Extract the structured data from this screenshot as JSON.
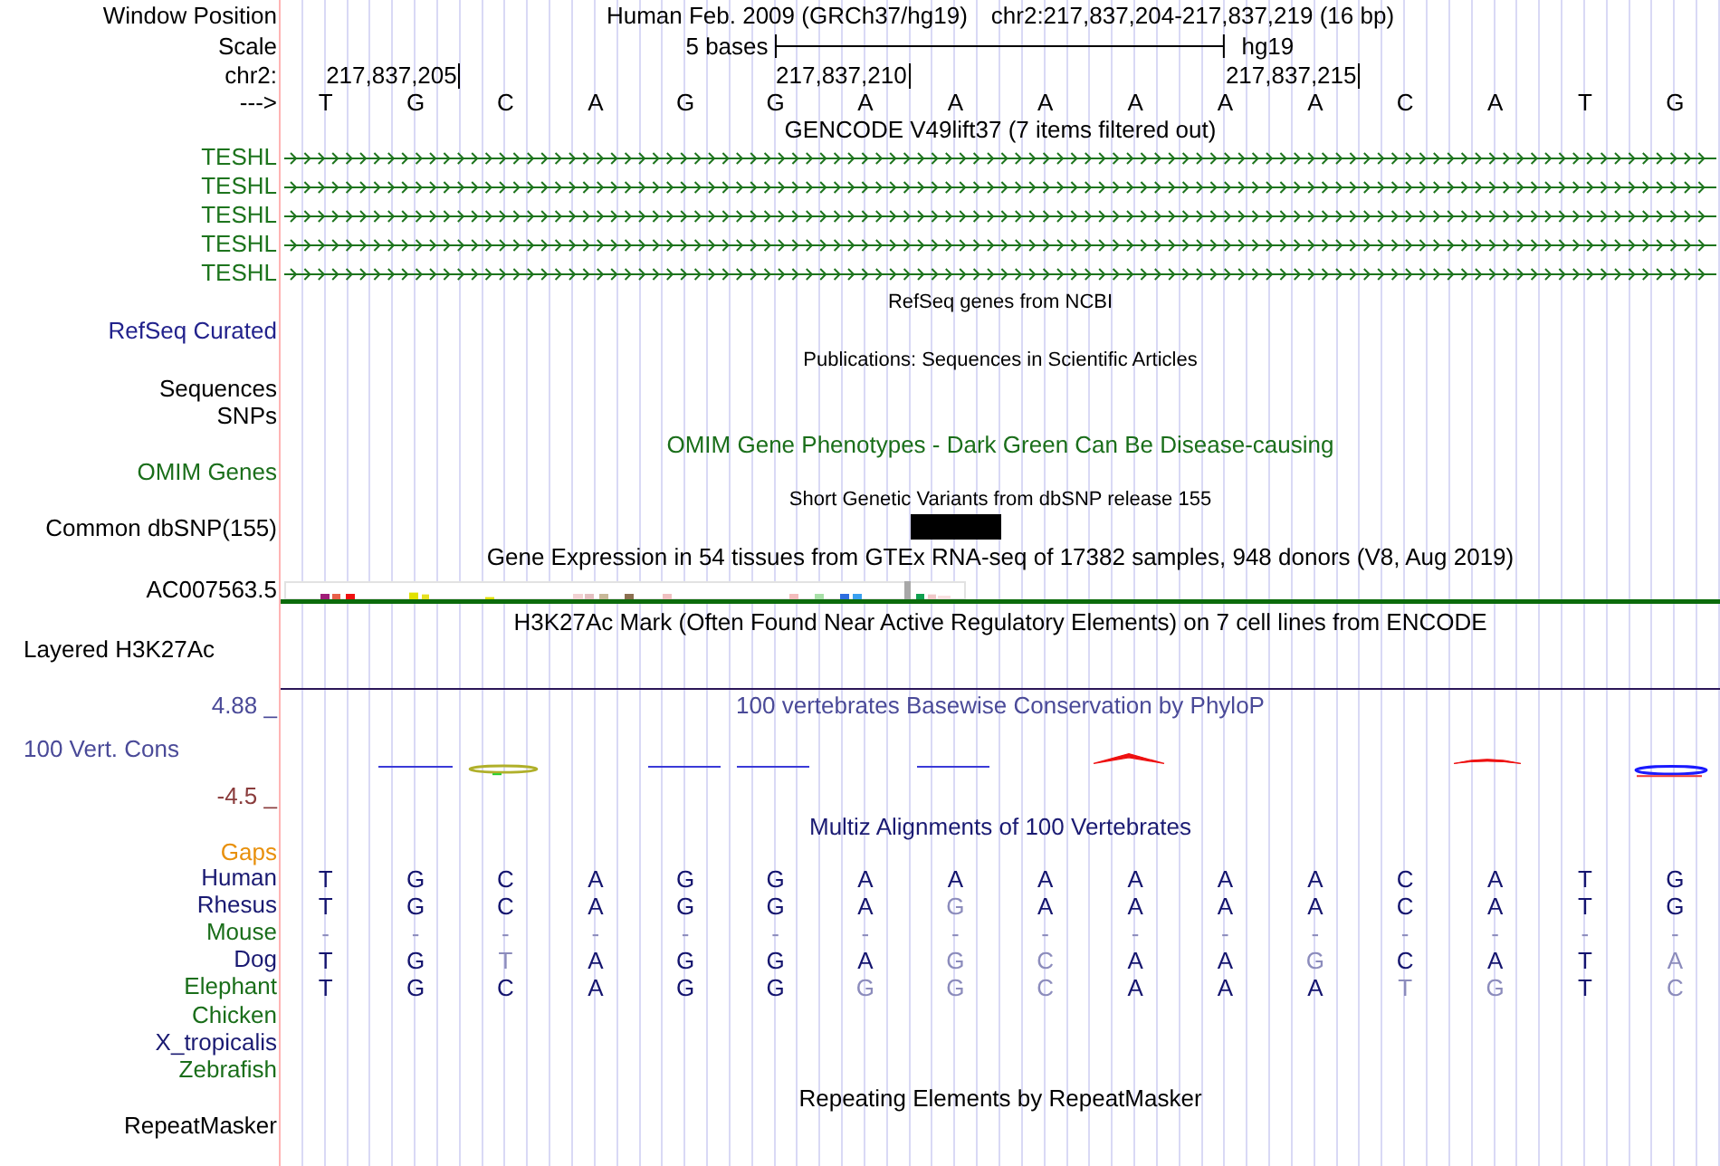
{
  "ruler": {
    "position_label": "Window Position",
    "assembly_title": "Human Feb. 2009 (GRCh37/hg19)",
    "position": "chr2:217,837,204-217,837,219 (16 bp)",
    "scale_label": "Scale",
    "scale_text": "5 bases",
    "scale_assembly": "hg19",
    "chrom_label": "chr2:",
    "ticks": [
      "217,837,205",
      "217,837,210",
      "217,837,215"
    ],
    "strand_label": "--->",
    "bases": [
      "T",
      "G",
      "C",
      "A",
      "G",
      "G",
      "A",
      "A",
      "A",
      "A",
      "A",
      "A",
      "C",
      "A",
      "T",
      "G"
    ]
  },
  "tracks": [
    {
      "kind": "genes",
      "title": "GENCODE V49lift37 (7 items filtered out)",
      "color": "#000000",
      "items": [
        {
          "label": "TESHL",
          "color": "#1d741d"
        },
        {
          "label": "TESHL",
          "color": "#1d741d"
        },
        {
          "label": "TESHL",
          "color": "#1d741d"
        },
        {
          "label": "TESHL",
          "color": "#1d741d"
        },
        {
          "label": "TESHL",
          "color": "#1d741d"
        }
      ]
    },
    {
      "kind": "compact",
      "title": "RefSeq genes from NCBI",
      "color": "#000000",
      "labels": [
        {
          "text": "RefSeq Curated",
          "color": "#22228c"
        }
      ]
    },
    {
      "kind": "compact",
      "title": "Publications: Sequences in Scientific Articles",
      "color": "#000000",
      "labels": [
        {
          "text": "Sequences",
          "color": "#000000"
        },
        {
          "text": "SNPs",
          "color": "#000000"
        }
      ]
    },
    {
      "kind": "plain",
      "title": "OMIM Gene Phenotypes - Dark Green Can Be Disease-causing",
      "color": "#1a6e1a",
      "labels": [
        {
          "text": "OMIM Genes",
          "color": "#1a6e1a"
        }
      ]
    },
    {
      "kind": "variants",
      "title": "Short Genetic Variants from dbSNP release 155",
      "color": "#000000",
      "labels": [
        {
          "text": "Common dbSNP(155)",
          "color": "#000000"
        }
      ]
    },
    {
      "kind": "expression",
      "title": "Gene Expression in 54 tissues from GTEx RNA-seq of 17382 samples, 948 donors (V8, Aug 2019)",
      "color": "#000000",
      "labels": [
        {
          "text": "AC007563.5",
          "color": "#000000"
        }
      ]
    },
    {
      "kind": "signal",
      "title": "H3K27Ac Mark (Often Found Near Active Regulatory Elements) on 7 cell lines from ENCODE",
      "color": "#000000",
      "labels": [
        {
          "text": "Layered H3K27Ac",
          "color": "#000000"
        }
      ]
    },
    {
      "kind": "conservation",
      "title": "100 vertebrates Basewise Conservation by PhyloP",
      "color": "#4a4a98",
      "max_label": {
        "text": "4.88 _",
        "color": "#4a4a98"
      },
      "labels": [
        {
          "text": "100 Vert. Cons",
          "color": "#4a4a98"
        }
      ],
      "min_label": {
        "text": "-4.5 _",
        "color": "#8a3c3c"
      }
    },
    {
      "kind": "alignment",
      "title": "Multiz Alignments of 100 Vertebrates",
      "color": "#1a1a72",
      "gaps_label": {
        "text": "Gaps",
        "color": "#e8900c"
      },
      "species": [
        {
          "name": "Human",
          "color": "#1a1a72",
          "bases": [
            {
              "base": "T",
              "match": true
            },
            {
              "base": "G",
              "match": true
            },
            {
              "base": "C",
              "match": true
            },
            {
              "base": "A",
              "match": true
            },
            {
              "base": "G",
              "match": true
            },
            {
              "base": "G",
              "match": true
            },
            {
              "base": "A",
              "match": true
            },
            {
              "base": "A",
              "match": true
            },
            {
              "base": "A",
              "match": true
            },
            {
              "base": "A",
              "match": true
            },
            {
              "base": "A",
              "match": true
            },
            {
              "base": "A",
              "match": true
            },
            {
              "base": "C",
              "match": true
            },
            {
              "base": "A",
              "match": true
            },
            {
              "base": "T",
              "match": true
            },
            {
              "base": "G",
              "match": true
            }
          ]
        },
        {
          "name": "Rhesus",
          "color": "#1a1a72",
          "bases": [
            {
              "base": "T",
              "match": true
            },
            {
              "base": "G",
              "match": true
            },
            {
              "base": "C",
              "match": true
            },
            {
              "base": "A",
              "match": true
            },
            {
              "base": "G",
              "match": true
            },
            {
              "base": "G",
              "match": true
            },
            {
              "base": "A",
              "match": true
            },
            {
              "base": "G",
              "match": false
            },
            {
              "base": "A",
              "match": true
            },
            {
              "base": "A",
              "match": true
            },
            {
              "base": "A",
              "match": true
            },
            {
              "base": "A",
              "match": true
            },
            {
              "base": "C",
              "match": true
            },
            {
              "base": "A",
              "match": true
            },
            {
              "base": "T",
              "match": true
            },
            {
              "base": "G",
              "match": true
            }
          ]
        },
        {
          "name": "Mouse",
          "color": "#1a6e1a",
          "bases": [
            {
              "base": "-",
              "match": false
            },
            {
              "base": "-",
              "match": false
            },
            {
              "base": "-",
              "match": false
            },
            {
              "base": "-",
              "match": false
            },
            {
              "base": "-",
              "match": false
            },
            {
              "base": "-",
              "match": false
            },
            {
              "base": "-",
              "match": false
            },
            {
              "base": "-",
              "match": false
            },
            {
              "base": "-",
              "match": false
            },
            {
              "base": "-",
              "match": false
            },
            {
              "base": "-",
              "match": false
            },
            {
              "base": "-",
              "match": false
            },
            {
              "base": "-",
              "match": false
            },
            {
              "base": "-",
              "match": false
            },
            {
              "base": "-",
              "match": false
            },
            {
              "base": "-",
              "match": false
            }
          ]
        },
        {
          "name": "Dog",
          "color": "#1a1a72",
          "bases": [
            {
              "base": "T",
              "match": true
            },
            {
              "base": "G",
              "match": true
            },
            {
              "base": "T",
              "match": false
            },
            {
              "base": "A",
              "match": true
            },
            {
              "base": "G",
              "match": true
            },
            {
              "base": "G",
              "match": true
            },
            {
              "base": "A",
              "match": true
            },
            {
              "base": "G",
              "match": false
            },
            {
              "base": "C",
              "match": false
            },
            {
              "base": "A",
              "match": true
            },
            {
              "base": "A",
              "match": true
            },
            {
              "base": "G",
              "match": false
            },
            {
              "base": "C",
              "match": true
            },
            {
              "base": "A",
              "match": true
            },
            {
              "base": "T",
              "match": true
            },
            {
              "base": "A",
              "match": false
            }
          ]
        },
        {
          "name": "Elephant",
          "color": "#1a6e1a",
          "bases": [
            {
              "base": "T",
              "match": true
            },
            {
              "base": "G",
              "match": true
            },
            {
              "base": "C",
              "match": true
            },
            {
              "base": "A",
              "match": true
            },
            {
              "base": "G",
              "match": true
            },
            {
              "base": "G",
              "match": true
            },
            {
              "base": "G",
              "match": false
            },
            {
              "base": "G",
              "match": false
            },
            {
              "base": "C",
              "match": false
            },
            {
              "base": "A",
              "match": true
            },
            {
              "base": "A",
              "match": true
            },
            {
              "base": "A",
              "match": true
            },
            {
              "base": "T",
              "match": false
            },
            {
              "base": "G",
              "match": false
            },
            {
              "base": "T",
              "match": true
            },
            {
              "base": "C",
              "match": false
            }
          ]
        },
        {
          "name": "Chicken",
          "color": "#1a6e1a"
        },
        {
          "name": "X_tropicalis",
          "color": "#1a1a72"
        },
        {
          "name": "Zebrafish",
          "color": "#1a6e1a"
        }
      ]
    },
    {
      "kind": "plain",
      "title": "Repeating Elements by RepeatMasker",
      "color": "#000000",
      "labels": [
        {
          "text": "RepeatMasker",
          "color": "#000000"
        }
      ]
    }
  ]
}
